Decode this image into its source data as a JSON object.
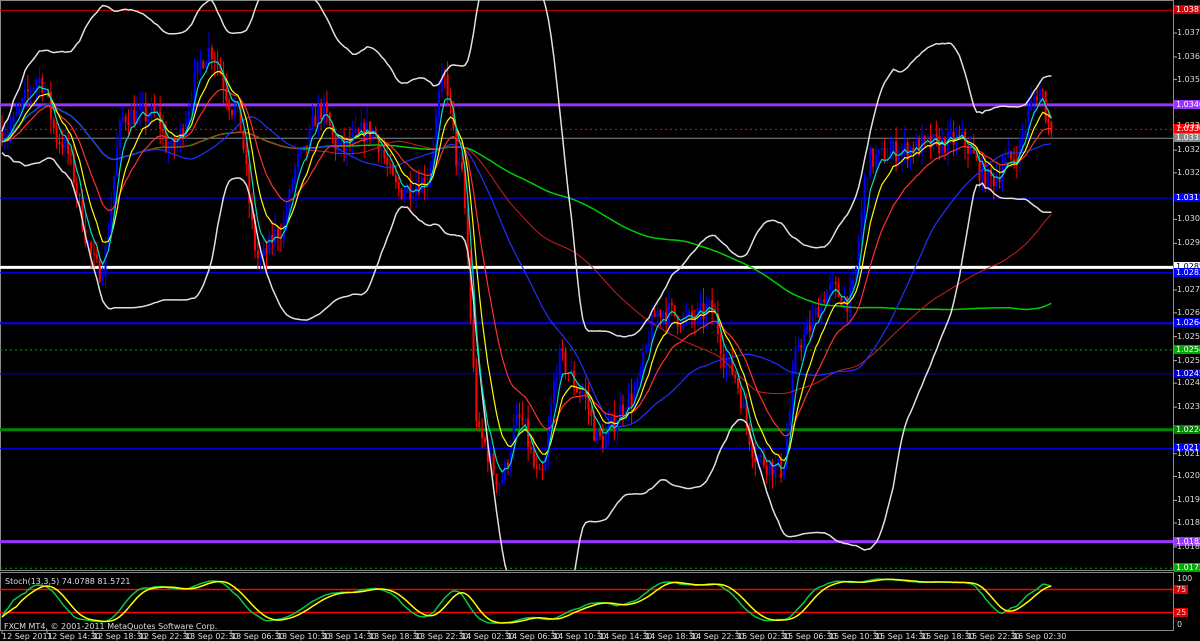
{
  "window": {
    "watermark": "FXCM MT4, © 2001-2011 MetaQuotes Software Corp."
  },
  "indicator": {
    "label": "Stoch(13,3,5) 74.0788 81.5721",
    "levels": [
      100,
      75,
      25,
      0
    ],
    "level_tags": [
      "75",
      "25"
    ]
  },
  "price_axis": {
    "ticks": [
      "1.03730",
      "1.03640",
      "1.03555",
      "1.03380",
      "1.03290",
      "1.03205",
      "1.03030",
      "1.02940",
      "1.02765",
      "1.02679",
      "1.02590",
      "1.02500",
      "1.02415",
      "1.02325",
      "1.02150",
      "1.02065",
      "1.01975",
      "1.01890",
      "1.01800"
    ]
  },
  "lines": [
    {
      "price": "1.03815",
      "color": "#cc0000",
      "style": "thin",
      "tag": true
    },
    {
      "price": "1.03460",
      "color": "#9933ff",
      "style": "thick",
      "tag": true
    },
    {
      "price": "1.03368",
      "color": "#ff0000",
      "style": "dotted",
      "tag": true
    },
    {
      "price": "1.03335",
      "color": "#888888",
      "style": "thin",
      "tag": true
    },
    {
      "price": "1.03110",
      "color": "#0000ff",
      "style": "thin",
      "tag": true
    },
    {
      "price": "1.02850",
      "color": "#ffffff",
      "style": "thick",
      "tag": true
    },
    {
      "price": "1.02830",
      "color": "#0000ff",
      "style": "thin",
      "tag": true
    },
    {
      "price": "1.02640",
      "color": "#0000ff",
      "style": "medium",
      "tag": true
    },
    {
      "price": "1.02540",
      "color": "#00aa00",
      "style": "dotted",
      "tag": true
    },
    {
      "price": "1.02450",
      "color": "#0000cc",
      "style": "thin",
      "tag": true
    },
    {
      "price": "1.02240",
      "color": "#008800",
      "style": "thick",
      "tag": true
    },
    {
      "price": "1.02170",
      "color": "#0000ff",
      "style": "thin",
      "tag": true
    },
    {
      "price": "1.01820",
      "color": "#9933ff",
      "style": "thick",
      "tag": true
    },
    {
      "price": "1.01720",
      "color": "#00aa00",
      "style": "dotted",
      "tag": true
    }
  ],
  "time_axis": {
    "labels": [
      "12 Sep 2011",
      "12 Sep 14:30",
      "12 Sep 18:30",
      "12 Sep 22:30",
      "13 Sep 02:30",
      "13 Sep 06:30",
      "13 Sep 10:30",
      "13 Sep 14:30",
      "13 Sep 18:30",
      "13 Sep 22:30",
      "14 Sep 02:30",
      "14 Sep 06:30",
      "14 Sep 10:30",
      "14 Sep 14:30",
      "14 Sep 18:30",
      "14 Sep 22:30",
      "15 Sep 02:30",
      "15 Sep 06:30",
      "15 Sep 10:30",
      "15 Sep 14:30",
      "15 Sep 18:30",
      "15 Sep 22:30",
      "16 Sep 02:30"
    ]
  },
  "colors": {
    "bull": "#0000ff",
    "bear": "#ff0000",
    "ema_fast": "#00e0c0",
    "ema_mid": "#ffff00",
    "ema_slow": "#ff3030",
    "sma50": "#2030ff",
    "sma100": "#cc2020",
    "sma200": "#00cc00",
    "bands": "#e0e0e0",
    "stoch_main": "#00cc44",
    "stoch_signal": "#ffff00"
  },
  "chart_data": {
    "type": "candlestick",
    "symbol_timeframe": "M15",
    "price_path_hours": [
      0.3,
      3.3,
      5.0,
      8.5,
      10.7,
      13.3,
      14.6,
      18.1,
      20.3,
      22.4,
      24.2,
      25.9,
      27.7,
      29.4,
      32.0,
      34.6,
      36.8,
      38.5,
      39.8,
      41.6,
      43.3,
      45.0,
      46.8,
      48.5,
      50.3,
      52.0,
      54.6,
      57.2,
      59.8,
      61.6,
      63.3,
      65.9,
      67.7,
      69.4,
      72.0,
      73.7,
      75.5,
      78.1,
      80.7,
      83.3,
      85.9,
      87.7,
      90.3,
      91.1
    ],
    "price_path_values": [
      1.03366,
      1.03554,
      1.03328,
      1.0284,
      1.03422,
      1.03422,
      1.03291,
      1.03666,
      1.03441,
      1.02878,
      1.0299,
      1.03253,
      1.03441,
      1.03291,
      1.03366,
      1.0314,
      1.03178,
      1.03554,
      1.03216,
      1.02202,
      1.02051,
      1.02277,
      1.02051,
      1.02502,
      1.0239,
      1.02202,
      1.02352,
      1.0269,
      1.02652,
      1.0269,
      1.02465,
      1.02127,
      1.02089,
      1.02577,
      1.02765,
      1.02727,
      1.03253,
      1.03291,
      1.03309,
      1.03328,
      1.03178,
      1.03253,
      1.03516,
      1.03385
    ],
    "ylim": [
      1.017,
      1.0386
    ]
  }
}
